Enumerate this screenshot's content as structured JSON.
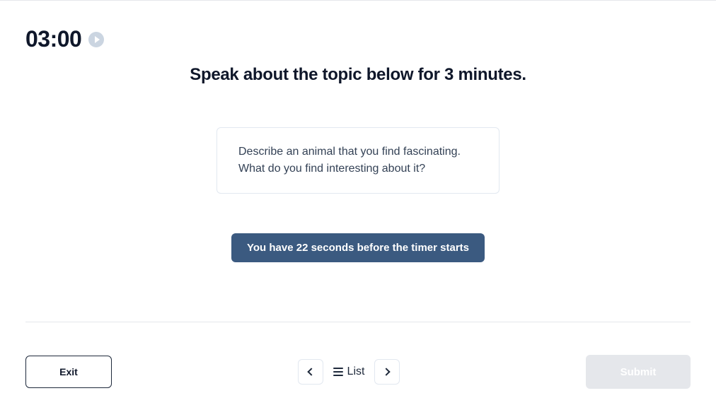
{
  "timer": {
    "display": "03:00"
  },
  "instruction": "Speak about the topic below for 3 minutes.",
  "topic": {
    "line1": "Describe an animal that you find fascinating.",
    "line2": "What do you find interesting about it?"
  },
  "countdown": "You have 22 seconds before the timer starts",
  "footer": {
    "exit_label": "Exit",
    "list_label": "List",
    "submit_label": "Submit"
  }
}
